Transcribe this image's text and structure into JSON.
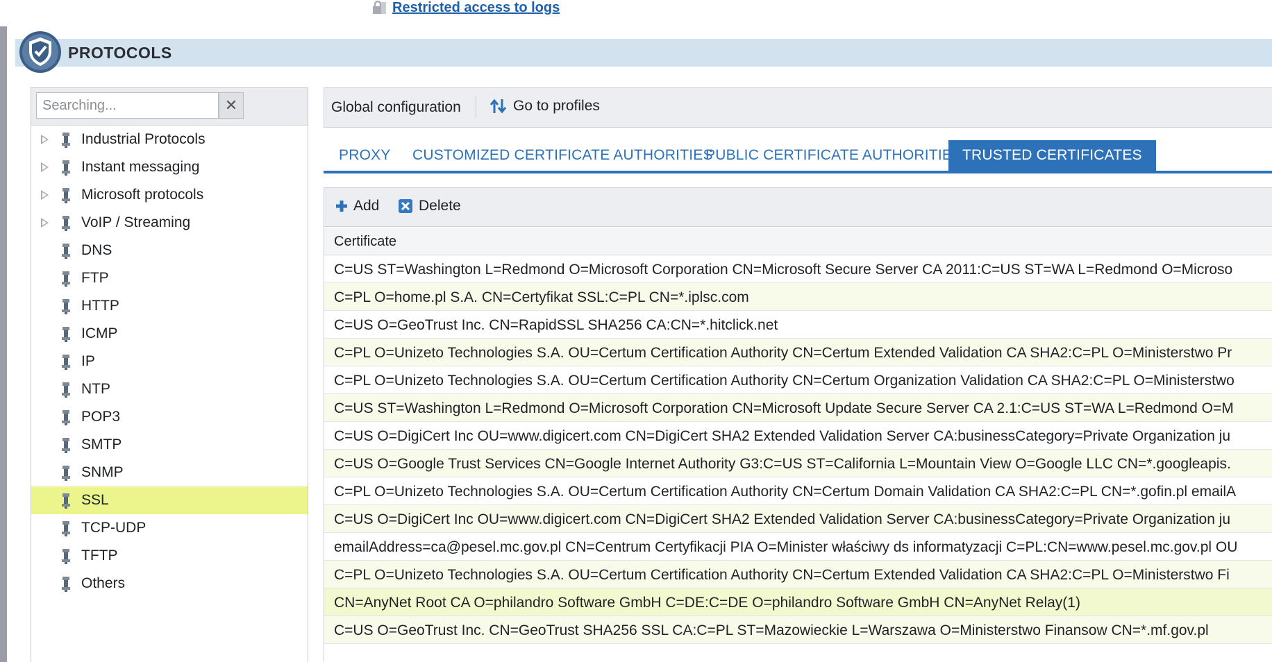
{
  "top_link": {
    "label": "Restricted access to logs"
  },
  "header": {
    "title": "PROTOCOLS"
  },
  "search": {
    "placeholder": "Searching...",
    "value": ""
  },
  "tree": [
    {
      "label": "Industrial Protocols",
      "expandable": true
    },
    {
      "label": "Instant messaging",
      "expandable": true
    },
    {
      "label": "Microsoft protocols",
      "expandable": true
    },
    {
      "label": "VoIP / Streaming",
      "expandable": true
    },
    {
      "label": "DNS"
    },
    {
      "label": "FTP"
    },
    {
      "label": "HTTP"
    },
    {
      "label": "ICMP"
    },
    {
      "label": "IP"
    },
    {
      "label": "NTP"
    },
    {
      "label": "POP3"
    },
    {
      "label": "SMTP"
    },
    {
      "label": "SNMP"
    },
    {
      "label": "SSL",
      "selected": true
    },
    {
      "label": "TCP-UDP"
    },
    {
      "label": "TFTP"
    },
    {
      "label": "Others"
    }
  ],
  "toolbar": {
    "global_config": "Global configuration",
    "profiles": "Go to profiles"
  },
  "tabs": [
    {
      "label": "PROXY"
    },
    {
      "label": "CUSTOMIZED CERTIFICATE AUTHORITIES"
    },
    {
      "label": "PUBLIC CERTIFICATE AUTHORITIES"
    },
    {
      "label": "TRUSTED CERTIFICATES",
      "active": true
    }
  ],
  "grid": {
    "add_label": "Add",
    "delete_label": "Delete",
    "column": "Certificate",
    "rows": [
      "C=US ST=Washington L=Redmond O=Microsoft Corporation CN=Microsoft Secure Server CA 2011:C=US ST=WA L=Redmond O=Microso",
      "C=PL O=home.pl S.A. CN=Certyfikat SSL:C=PL CN=*.iplsc.com",
      "C=US O=GeoTrust Inc. CN=RapidSSL SHA256 CA:CN=*.hitclick.net",
      "C=PL O=Unizeto Technologies S.A. OU=Certum Certification Authority CN=Certum Extended Validation CA SHA2:C=PL O=Ministerstwo Pr",
      "C=PL O=Unizeto Technologies S.A. OU=Certum Certification Authority CN=Certum Organization Validation CA SHA2:C=PL O=Ministerstwo",
      "C=US ST=Washington L=Redmond O=Microsoft Corporation CN=Microsoft Update Secure Server CA 2.1:C=US ST=WA L=Redmond O=M",
      "C=US O=DigiCert Inc OU=www.digicert.com CN=DigiCert SHA2 Extended Validation Server CA:businessCategory=Private Organization ju",
      "C=US O=Google Trust Services CN=Google Internet Authority G3:C=US ST=California L=Mountain View O=Google LLC CN=*.googleapis.",
      "C=PL O=Unizeto Technologies S.A. OU=Certum Certification Authority CN=Certum Domain Validation CA SHA2:C=PL CN=*.gofin.pl emailA",
      "C=US O=DigiCert Inc OU=www.digicert.com CN=DigiCert SHA2 Extended Validation Server CA:businessCategory=Private Organization ju",
      "emailAddress=ca@pesel.mc.gov.pl CN=Centrum Certyfikacji PIA O=Minister właściwy ds informatyzacji C=PL:CN=www.pesel.mc.gov.pl OU",
      "C=PL O=Unizeto Technologies S.A. OU=Certum Certification Authority CN=Certum Extended Validation CA SHA2:C=PL O=Ministerstwo Fi",
      "CN=AnyNet Root CA O=philandro Software GmbH C=DE:C=DE O=philandro Software GmbH CN=AnyNet Relay(1)",
      "C=US O=GeoTrust Inc. CN=GeoTrust SHA256 SSL CA:C=PL ST=Mazowieckie L=Warszawa O=Ministerstwo Finansow CN=*.mf.gov.pl"
    ],
    "highlighted_row": 12
  },
  "colors": {
    "accent": "#2d72b8",
    "selection": "#ebf58c",
    "header_band": "#d2e2ef"
  }
}
